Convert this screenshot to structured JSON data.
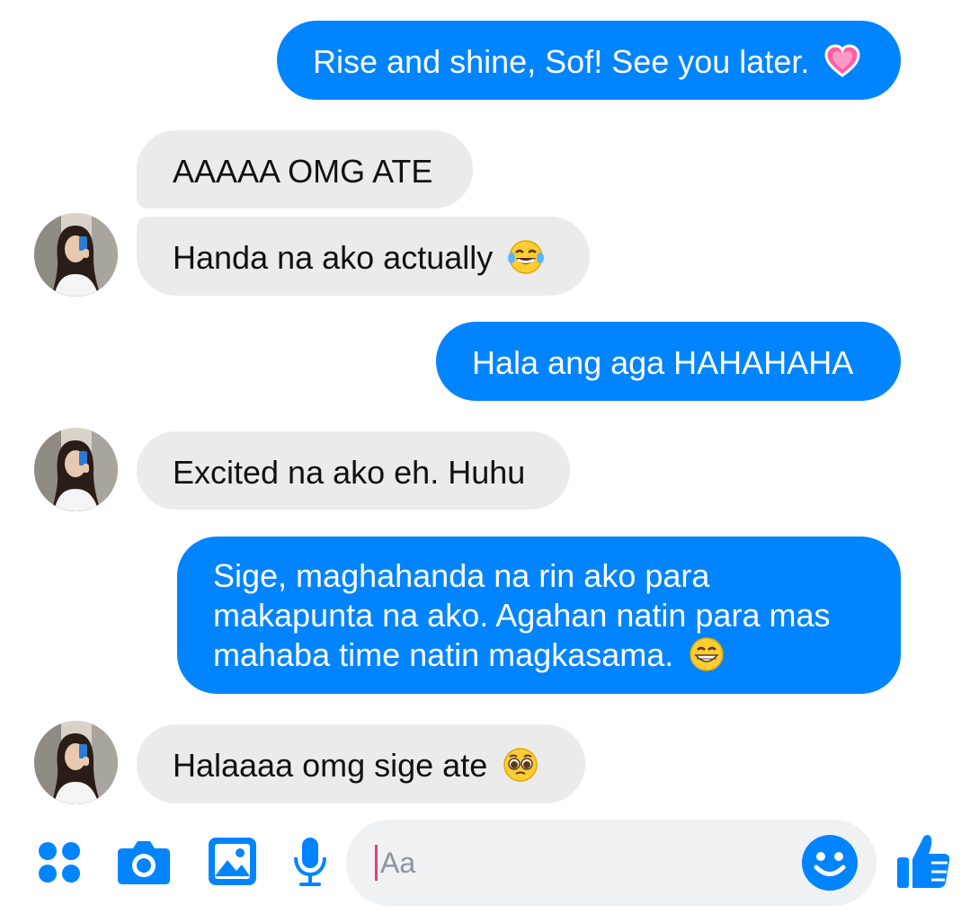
{
  "conversation": {
    "messages": [
      {
        "direction": "sent",
        "text": "Rise and shine, Sof! See you later.",
        "emoji": "growing-heart"
      },
      {
        "direction": "received",
        "text": "AAAAA OMG ATE"
      },
      {
        "direction": "received",
        "text": "Handa na ako actually",
        "emoji": "tears-of-joy"
      },
      {
        "direction": "sent",
        "text": "Hala ang aga HAHAHAHA"
      },
      {
        "direction": "received",
        "text": "Excited na ako eh. Huhu"
      },
      {
        "direction": "sent",
        "lines": [
          "Sige, maghahanda na rin ako para",
          "makapunta na ako. Agahan natin para mas",
          "mahaba time natin magkasama."
        ],
        "emoji": "grinning-face"
      },
      {
        "direction": "received",
        "text": "Halaaaa omg sige ate",
        "emoji": "pleading-face"
      }
    ]
  },
  "composer": {
    "placeholder": "Aa"
  },
  "toolbar": {
    "icons": [
      "apps-icon",
      "camera-icon",
      "gallery-icon",
      "microphone-icon",
      "emoji-icon",
      "thumbs-up-icon"
    ]
  },
  "colors": {
    "sent_bubble": "#0084ff",
    "received_bubble": "#ebebeb",
    "accent": "#0084ff",
    "composer_bg": "#f0f1f3"
  }
}
